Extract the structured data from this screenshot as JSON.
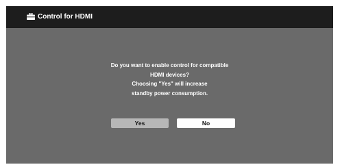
{
  "header": {
    "icon": "toolbox-icon",
    "title": "Control for HDMI"
  },
  "dialog": {
    "message_lines": [
      "Do you want to enable control for compatible",
      "HDMI devices?",
      "Choosing \"Yes\" will increase",
      "standby power consumption."
    ],
    "yes_label": "Yes",
    "no_label": "No",
    "selected": "Yes"
  },
  "colors": {
    "background": "#6a6a6a",
    "title_bar": "#1d1d1d",
    "selected_button": "#b7b7b7",
    "unselected_button": "#ffffff"
  }
}
